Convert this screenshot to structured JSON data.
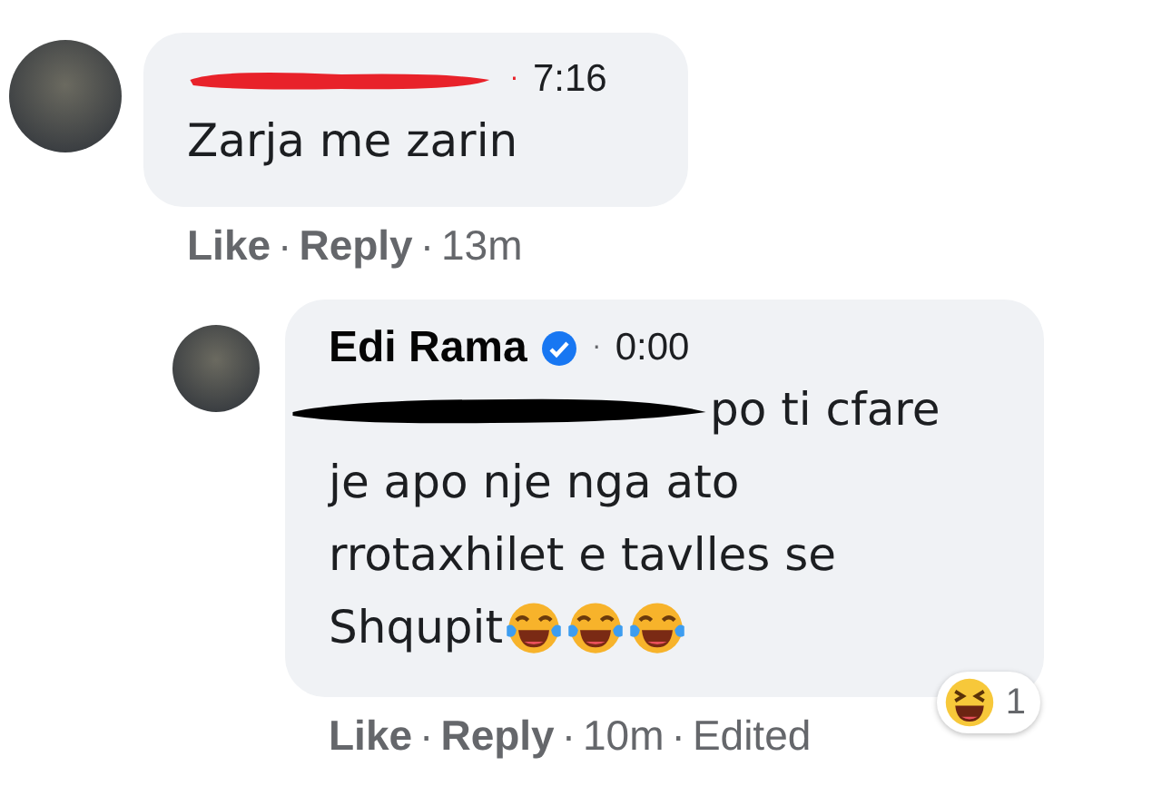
{
  "comments": [
    {
      "author_redacted": true,
      "verified": false,
      "separator": "·",
      "time": "7:16",
      "body_redacted_start": false,
      "body_lines": [
        "Zarja me zarin"
      ],
      "actions": [
        "Like",
        "Reply"
      ],
      "age": "13m",
      "reply": false
    },
    {
      "author_redacted": false,
      "author": "Edi Rama",
      "verified": true,
      "separator": "·",
      "time": "0:00",
      "body_redacted_start": true,
      "body_lines": [
        "po ti cfare",
        "je apo nje nga ato",
        "rrotaxhilet e tavlles se",
        "Shqupit"
      ],
      "emoji": [
        {
          "kind": "tears-of-joy"
        },
        {
          "kind": "tears-of-joy"
        },
        {
          "kind": "tears-of-joy"
        }
      ],
      "reaction": {
        "kind": "haha",
        "count": "1"
      },
      "actions": [
        "Like",
        "Reply"
      ],
      "age": "10m",
      "edited": "Edited",
      "reply": true
    }
  ]
}
